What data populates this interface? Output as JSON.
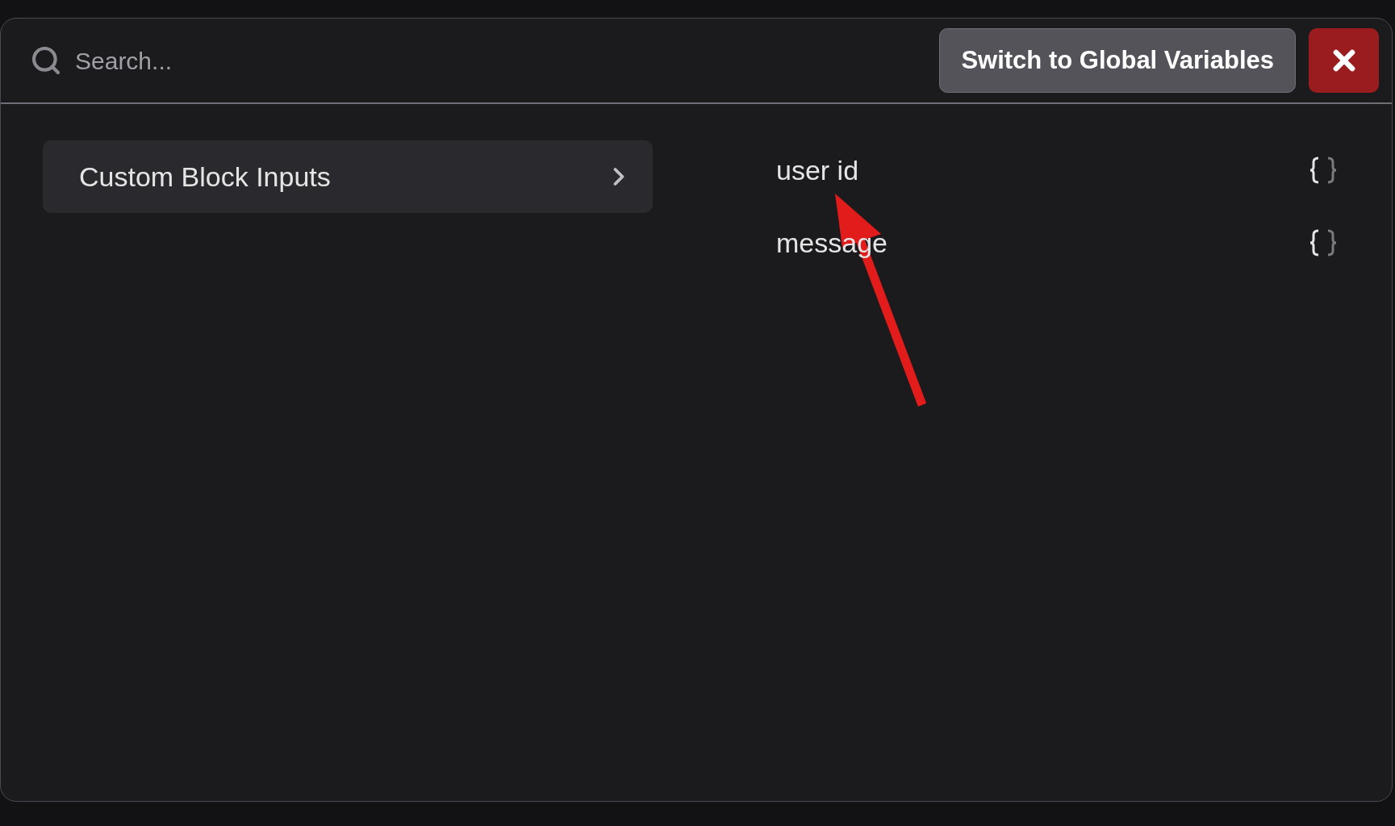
{
  "search": {
    "placeholder": "Search..."
  },
  "switch_button": "Switch to Global Variables",
  "categories": [
    {
      "label": "Custom Block Inputs",
      "selected": true
    }
  ],
  "variables": [
    {
      "name": "user id"
    },
    {
      "name": "message"
    }
  ]
}
